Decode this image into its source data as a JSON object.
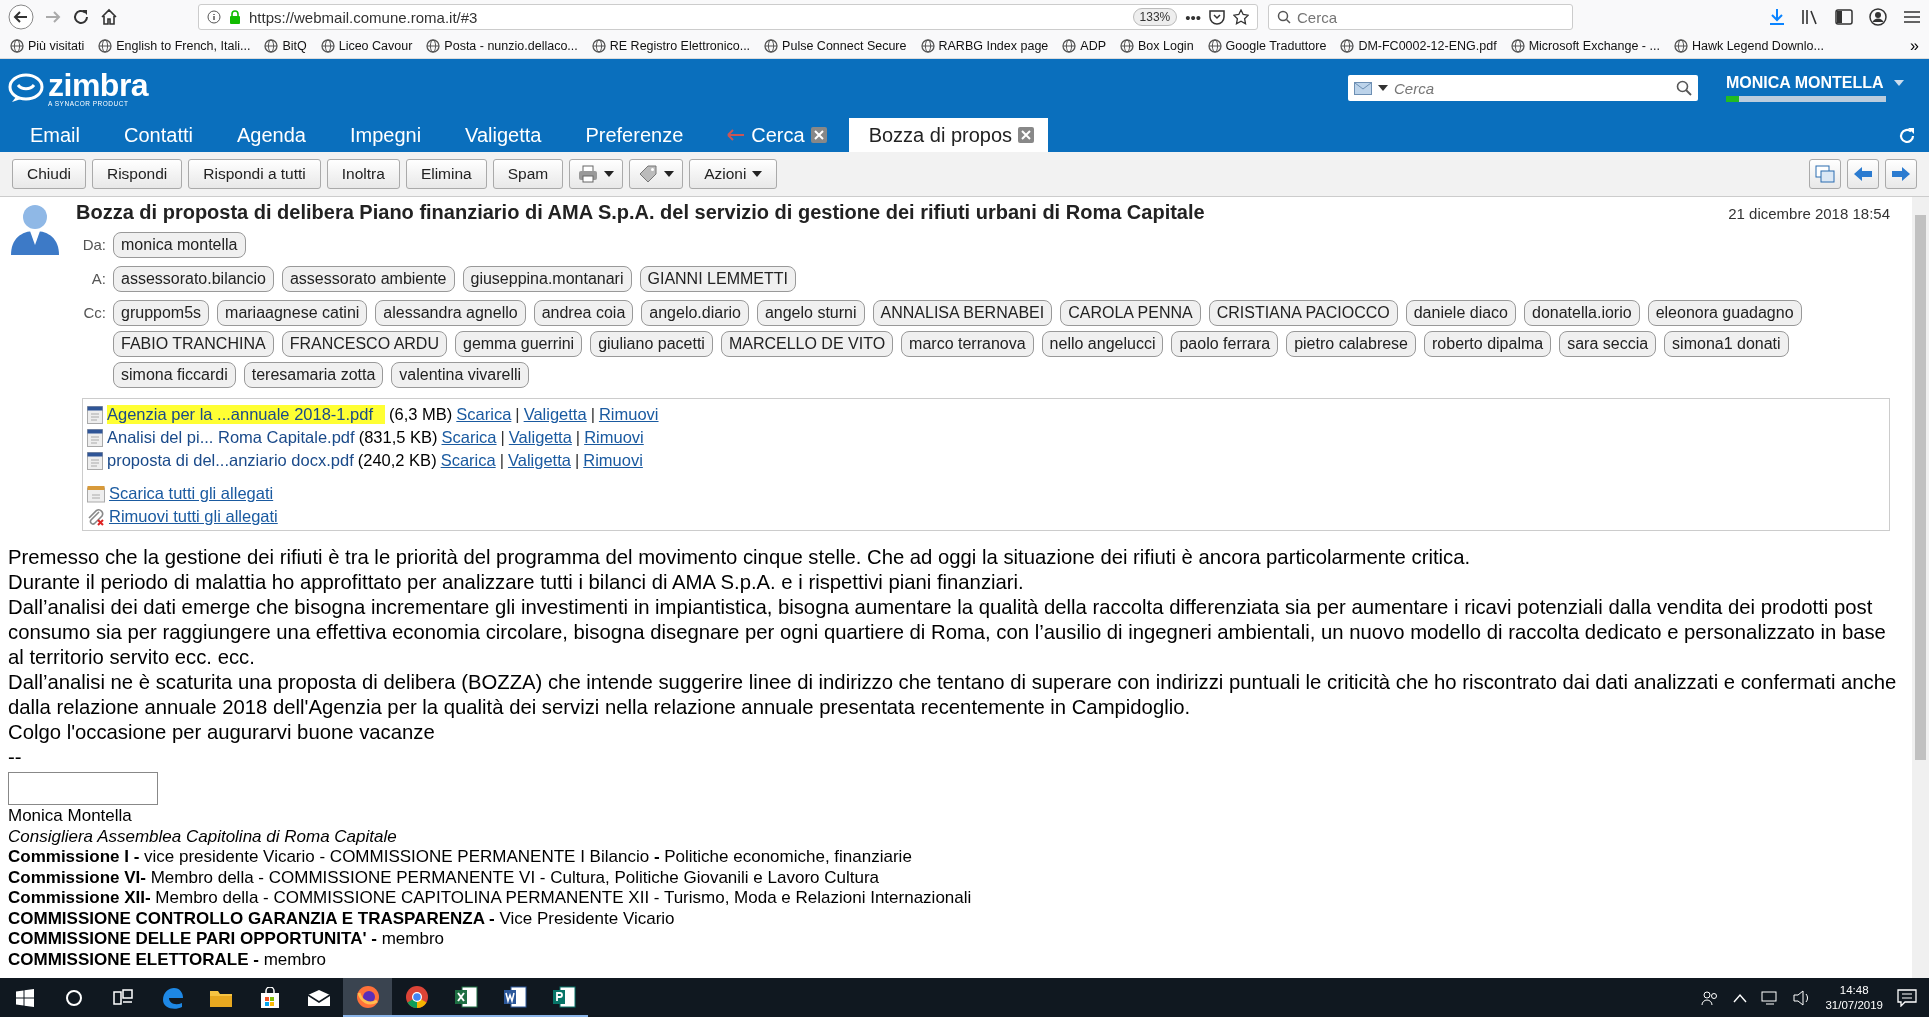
{
  "browser": {
    "url": "https://webmail.comune.roma.it/#3",
    "zoom": "133%",
    "more": "•••",
    "search": {
      "placeholder": "Cerca"
    },
    "bookmarks": [
      {
        "label": "Più visitati"
      },
      {
        "label": "English to French, Itali..."
      },
      {
        "label": "BitQ"
      },
      {
        "label": "Liceo Cavour"
      },
      {
        "label": "Posta - nunzio.dellaco..."
      },
      {
        "label": "RE Registro Elettronico..."
      },
      {
        "label": "Pulse Connect Secure"
      },
      {
        "label": "RARBG Index page"
      },
      {
        "label": "ADP"
      },
      {
        "label": "Box Login"
      },
      {
        "label": "Google Traduttore"
      },
      {
        "label": "DM-FC0002-12-ENG.pdf"
      },
      {
        "label": "Microsoft Exchange - ..."
      },
      {
        "label": "Hawk Legend Downlo..."
      }
    ],
    "overflow": "»"
  },
  "header": {
    "logo": "zimbra",
    "tagline": "A SYNACOR PRODUCT",
    "search": {
      "placeholder": "Cerca"
    },
    "user": "MONICA MONTELLA",
    "quota": {
      "level": 0.08
    }
  },
  "tabs": [
    {
      "label": "Email",
      "kind": "app",
      "selected": false
    },
    {
      "label": "Contatti",
      "kind": "app",
      "selected": false
    },
    {
      "label": "Agenda",
      "kind": "app",
      "selected": false
    },
    {
      "label": "Impegni",
      "kind": "app",
      "selected": false
    },
    {
      "label": "Valigetta",
      "kind": "app",
      "selected": false
    },
    {
      "label": "Preferenze",
      "kind": "app",
      "selected": false
    },
    {
      "label": "Cerca",
      "kind": "search",
      "selected": false
    },
    {
      "label": "Bozza di propos",
      "kind": "message",
      "selected": true
    }
  ],
  "toolbar": [
    {
      "kind": "button",
      "label": "Chiudi"
    },
    {
      "kind": "button",
      "label": "Rispondi"
    },
    {
      "kind": "button",
      "label": "Rispondi a tutti"
    },
    {
      "kind": "button",
      "label": "Inoltra"
    },
    {
      "kind": "button",
      "label": "Elimina"
    },
    {
      "kind": "button",
      "label": "Spam"
    },
    {
      "kind": "print"
    },
    {
      "kind": "tag"
    },
    {
      "kind": "menu",
      "label": "Azioni"
    }
  ],
  "message": {
    "subject": "Bozza di proposta di delibera Piano finanziario di AMA S.p.A. del servizio di gestione dei rifiuti urbani di Roma Capitale",
    "date": "21 dicembre 2018 18:54",
    "from": {
      "label": "Da:",
      "addresses": [
        "monica montella"
      ]
    },
    "to": {
      "label": "A:",
      "addresses": [
        "assessorato.bilancio",
        "assessorato ambiente",
        "giuseppina.montanari",
        "GIANNI LEMMETTI"
      ]
    },
    "cc": {
      "label": "Cc:",
      "addresses": [
        "gruppom5s",
        "mariaagnese catini",
        "alessandra agnello",
        "andrea coia",
        "angelo.diario",
        "angelo sturni",
        "ANNALISA BERNABEI",
        "CAROLA PENNA",
        "CRISTIANA PACIOCCO",
        "daniele diaco",
        "donatella.iorio",
        "eleonora guadagno",
        "FABIO TRANCHINA",
        "FRANCESCO ARDU",
        "gemma guerrini",
        "giuliano pacetti",
        "MARCELLO DE VITO",
        "marco terranova",
        "nello angelucci",
        "paolo ferrara",
        "pietro calabrese",
        "roberto dipalma",
        "sara seccia",
        "simona1 donati",
        "simona ficcardi",
        "teresamaria zotta",
        "valentina vivarelli"
      ]
    },
    "attachments": [
      {
        "name": "Agenzia per la ...annuale 2018-1.pdf",
        "size": "(6,3 MB)",
        "highlighted": true,
        "links": [
          "Scarica",
          "Valigetta",
          "Rimuovi"
        ],
        "separator": "|"
      },
      {
        "name": "Analisi del pi... Roma Capitale.pdf",
        "size": "(831,5 KB)",
        "highlighted": false,
        "links": [
          "Scarica",
          "Valigetta",
          "Rimuovi"
        ],
        "separator": "|"
      },
      {
        "name": "proposta di del...anziario docx.pdf",
        "size": "(240,2 KB)",
        "highlighted": false,
        "links": [
          "Scarica",
          "Valigetta",
          "Rimuovi"
        ],
        "separator": "|"
      }
    ],
    "download_all": "Scarica tutti gli allegati",
    "remove_all": "Rimuovi tutti gli allegati",
    "body": [
      "Premesso che la gestione dei rifiuti è tra le priorità del programma del movimento cinque stelle. Che ad oggi la situazione dei rifiuti è ancora particolarmente critica.",
      "Durante il periodo di malattia ho approfittato per analizzare tutti i bilanci di AMA S.p.A. e i rispettivi piani finanziari.",
      "Dall’analisi dei dati emerge che bisogna incrementare gli investimenti in impiantistica, bisogna aumentare la qualità della raccolta differenziata sia per aumentare i ricavi potenziali dalla vendita dei prodotti post consumo sia per raggiungere una effettiva economia circolare,  bisogna disegnare per ogni quartiere di Roma, con l’ausilio di ingegneri ambientali, un nuovo modello di raccolta dedicato e personalizzato in base al territorio servito ecc. ecc.",
      "Dall’analisi ne è scaturita una proposta di delibera (BOZZA) che intende suggerire linee di indirizzo che tentano di superare con indirizzi puntuali le criticità che ho riscontrato dai dati analizzati e confermati anche dalla relazione annuale 2018 dell'Agenzia per la qualità dei servizi nella relazione annuale presentata recentemente in Campidoglio.",
      "Colgo l'occasione per augurarvi buone vacanze",
      "--"
    ],
    "signature": {
      "name": "Monica Montella",
      "role": "Consigliera Assemblea Capitolina di Roma Capitale",
      "lines": [
        "**Commissione I -** vice presidente Vicario - COMMISSIONE PERMANENTE I Bilancio **-** Politiche economiche, finanziarie",
        "**Commissione VI-** Membro della - COMMISSIONE PERMANENTE VI - Cultura, Politiche Giovanili e Lavoro Cultura",
        "**Commissione XII-** Membro della - COMMISSIONE CAPITOLINA PERMANENTE XII - Turismo, Moda e Relazioni Internazionali",
        "**COMMISSIONE CONTROLLO GARANZIA E TRASPARENZA -** Vice Presidente Vicario",
        "**COMMISSIONE DELLE PARI OPPORTUNITA' -** membro",
        "**COMMISSIONE ELETTORALE -** membro"
      ]
    }
  },
  "taskbar": {
    "apps": [
      {
        "kind": "start",
        "running": false,
        "selected": false
      },
      {
        "kind": "search",
        "running": false,
        "selected": false
      },
      {
        "kind": "taskview",
        "running": false,
        "selected": false
      },
      {
        "kind": "edge",
        "running": false,
        "selected": false
      },
      {
        "kind": "folder",
        "running": false,
        "selected": false
      },
      {
        "kind": "store",
        "running": false,
        "selected": false
      },
      {
        "kind": "mail",
        "running": false,
        "selected": false
      },
      {
        "kind": "firefox",
        "running": true,
        "selected": true
      },
      {
        "kind": "chrome",
        "running": true,
        "selected": false
      },
      {
        "kind": "excel",
        "running": true,
        "selected": false
      },
      {
        "kind": "word",
        "running": true,
        "selected": false
      },
      {
        "kind": "publisher",
        "running": true,
        "selected": false
      }
    ],
    "time": "14:48",
    "date": "31/07/2019"
  }
}
